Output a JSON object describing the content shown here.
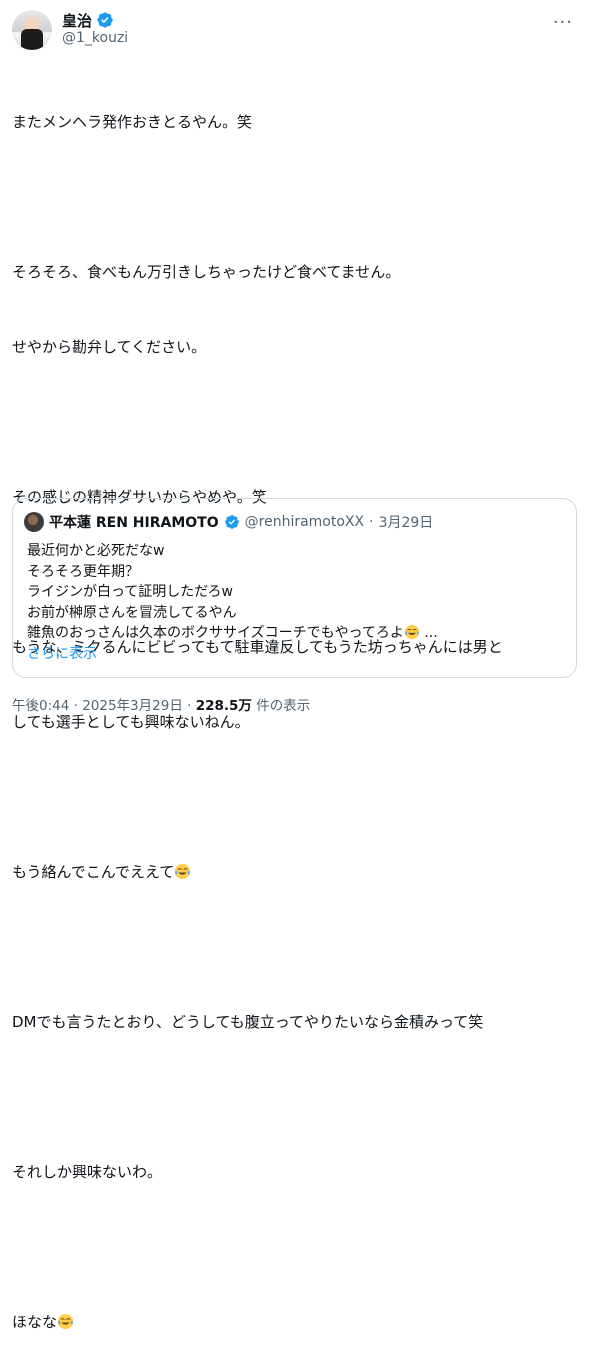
{
  "author": {
    "display_name": "皇治",
    "handle": "@1_kouzi",
    "more_label": "···"
  },
  "tweet_lines": [
    "またメンヘラ発作おきとるやん。笑",
    "",
    "そろそろ、食べもん万引きしちゃったけど食べてません。",
    "せやから勘弁してください。",
    "",
    "その感じの精神ダサいからやめや。笑",
    "",
    "もうな、ミクるんにビビってもて駐車違反してもうた坊っちゃんには男と",
    "しても選手としても興味ないねん。",
    "",
    "もう絡んでこんでええて",
    "",
    "DMでも言うたとおり、どうしても腹立ってやりたいなら金積みって笑",
    "",
    "それしか興味ないわ。",
    "",
    "ほなな"
  ],
  "quote": {
    "display_name": "平本蓮 REN HIRAMOTO",
    "handle": "@renhiramotoXX",
    "separator": "·",
    "date": "3月29日",
    "lines": [
      "最近何かと必死だなw",
      "そろそろ更年期？",
      "ライジンが白って証明しただろw",
      "お前が榊原さんを冒涜してるやん",
      "雑魚のおっさんは久本のボクササイズコーチでもやってろよ"
    ],
    "ellipsis": " ...",
    "show_more": "さらに表示"
  },
  "footer": {
    "time": "午後0:44",
    "separator": " · ",
    "date": "2025年3月29日",
    "views": "228.5万",
    "views_label": " 件の表示"
  },
  "colors": {
    "verified": "#1d9bf0",
    "link": "#1d9bf0",
    "muted": "#536471"
  }
}
